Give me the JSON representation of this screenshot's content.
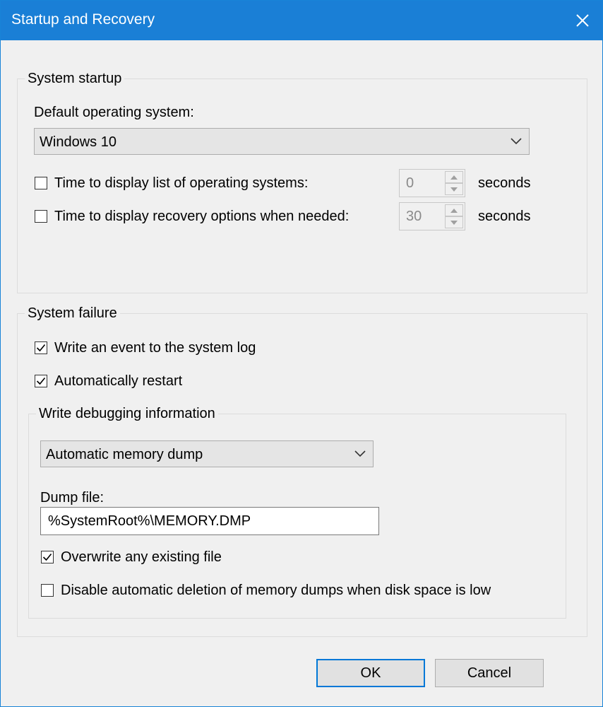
{
  "window": {
    "title": "Startup and Recovery",
    "accent_color": "#1a7fd6",
    "close_icon": "close-icon"
  },
  "system_startup": {
    "group_label": "System startup",
    "default_os_label": "Default operating system:",
    "default_os_value": "Windows 10",
    "time_list": {
      "label": "Time to display list of operating systems:",
      "checked": false,
      "value": "0",
      "unit": "seconds"
    },
    "time_recovery": {
      "label": "Time to display recovery options when needed:",
      "checked": false,
      "value": "30",
      "unit": "seconds"
    }
  },
  "system_failure": {
    "group_label": "System failure",
    "write_event": {
      "label": "Write an event to the system log",
      "checked": true
    },
    "auto_restart": {
      "label": "Automatically restart",
      "checked": true
    },
    "debug": {
      "group_label": "Write debugging information",
      "dump_type": "Automatic memory dump",
      "dump_file_label": "Dump file:",
      "dump_file_value": "%SystemRoot%\\MEMORY.DMP",
      "overwrite": {
        "label": "Overwrite any existing file",
        "checked": true
      },
      "disable_deletion": {
        "label": "Disable automatic deletion of memory dumps when disk space is low",
        "checked": false
      }
    }
  },
  "buttons": {
    "ok": "OK",
    "cancel": "Cancel"
  }
}
